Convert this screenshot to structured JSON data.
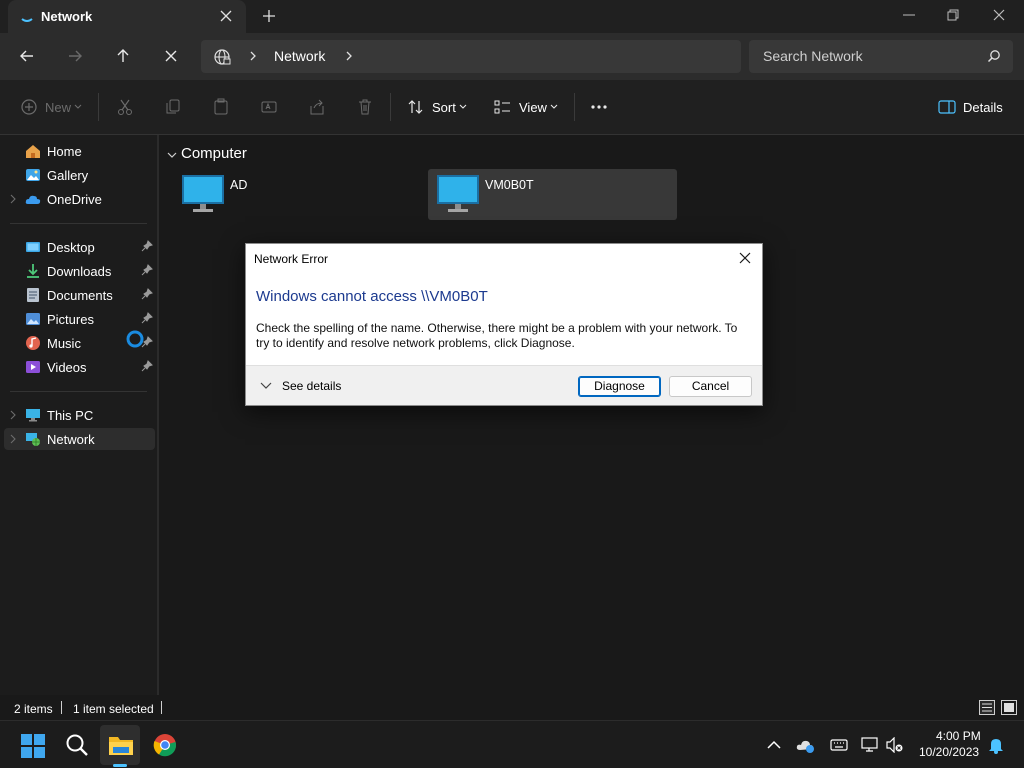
{
  "window": {
    "tab_title": "Network",
    "new_tab_icon": "plus-icon"
  },
  "navigation": {
    "breadcrumb": [
      "Network"
    ],
    "search_placeholder": "Search Network"
  },
  "command_bar": {
    "new_label": "New",
    "sort_label": "Sort",
    "view_label": "View",
    "details_label": "Details"
  },
  "sidebar": {
    "quick": [
      {
        "label": "Home",
        "icon": "home-icon"
      },
      {
        "label": "Gallery",
        "icon": "gallery-icon"
      },
      {
        "label": "OneDrive",
        "icon": "onedrive-icon"
      }
    ],
    "pinned": [
      {
        "label": "Desktop",
        "icon": "desktop-folder-icon"
      },
      {
        "label": "Downloads",
        "icon": "downloads-folder-icon"
      },
      {
        "label": "Documents",
        "icon": "documents-folder-icon"
      },
      {
        "label": "Pictures",
        "icon": "pictures-folder-icon"
      },
      {
        "label": "Music",
        "icon": "music-folder-icon"
      },
      {
        "label": "Videos",
        "icon": "videos-folder-icon"
      }
    ],
    "locations": [
      {
        "label": "This PC",
        "icon": "this-pc-icon"
      },
      {
        "label": "Network",
        "icon": "network-icon",
        "selected": true
      }
    ]
  },
  "content": {
    "group_label": "Computer",
    "items": [
      {
        "name": "AD",
        "icon": "computer-icon",
        "selected": false
      },
      {
        "name": "VM0B0T",
        "icon": "computer-icon",
        "selected": true
      }
    ]
  },
  "status_bar": {
    "item_count": "2 items",
    "selection": "1 item selected"
  },
  "dialog": {
    "title": "Network Error",
    "heading": "Windows cannot access \\\\VM0B0T",
    "message": "Check the spelling of the name. Otherwise, there might be a problem with your network. To try to identify and resolve network problems, click Diagnose.",
    "see_details_label": "See details",
    "diagnose_label": "Diagnose",
    "cancel_label": "Cancel"
  },
  "taskbar": {
    "time": "4:00 PM",
    "date": "10/20/2023"
  },
  "colors": {
    "accent": "#4cc2ff",
    "dialog_heading": "#1c3a8f",
    "primary_button_border": "#0067c0"
  }
}
